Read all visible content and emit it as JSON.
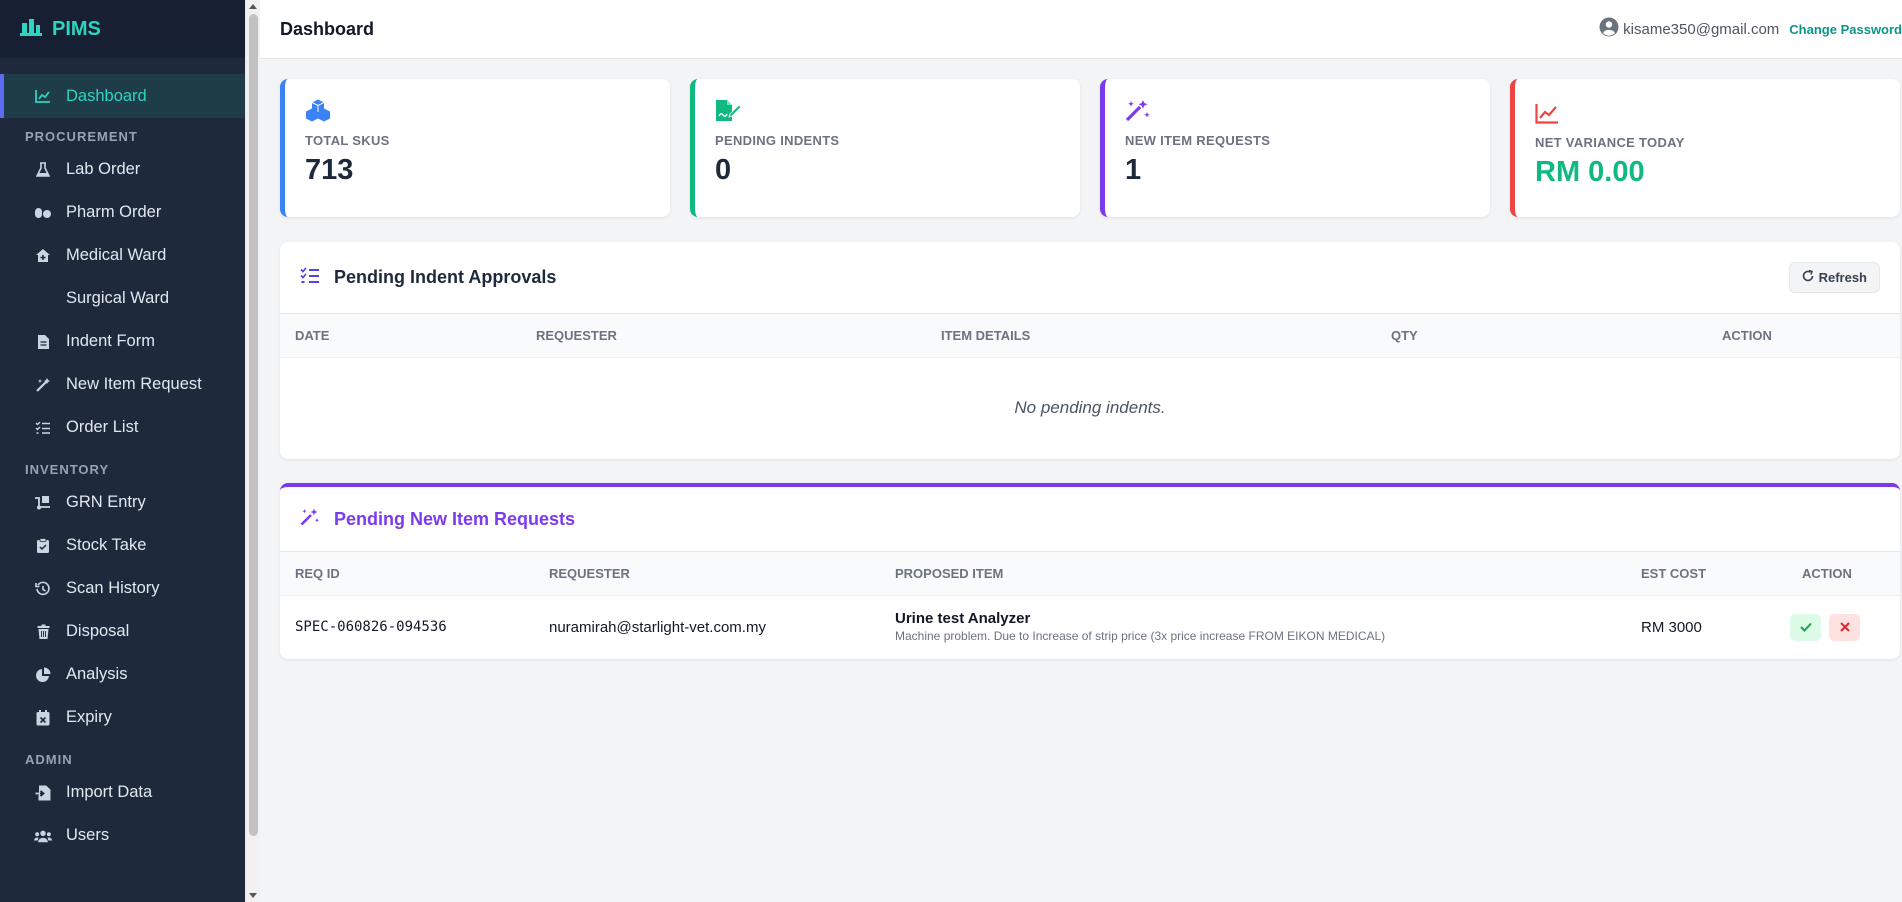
{
  "brand": {
    "name": "PIMS"
  },
  "sidebar": {
    "dashboard": "Dashboard",
    "sections": [
      {
        "label": "PROCUREMENT",
        "items": [
          {
            "label": "Lab Order",
            "icon": "flask-icon"
          },
          {
            "label": "Pharm Order",
            "icon": "pills-icon"
          },
          {
            "label": "Medical Ward",
            "icon": "house-medical-icon"
          },
          {
            "label": "Surgical Ward",
            "icon": ""
          },
          {
            "label": "Indent Form",
            "icon": "file-icon"
          },
          {
            "label": "New Item Request",
            "icon": "magic-wand-icon"
          },
          {
            "label": "Order List",
            "icon": "list-check-icon"
          }
        ]
      },
      {
        "label": "INVENTORY",
        "items": [
          {
            "label": "GRN Entry",
            "icon": "truck-ramp-icon"
          },
          {
            "label": "Stock Take",
            "icon": "clipboard-check-icon"
          },
          {
            "label": "Scan History",
            "icon": "history-icon"
          },
          {
            "label": "Disposal",
            "icon": "trash-icon"
          },
          {
            "label": "Analysis",
            "icon": "pie-chart-icon"
          },
          {
            "label": "Expiry",
            "icon": "calendar-x-icon"
          }
        ]
      },
      {
        "label": "ADMIN",
        "items": [
          {
            "label": "Import Data",
            "icon": "file-import-icon"
          },
          {
            "label": "Users",
            "icon": "users-icon"
          }
        ]
      }
    ]
  },
  "header": {
    "title": "Dashboard",
    "user_email": "kisame350@gmail.com",
    "change_password": "Change Password"
  },
  "stats": [
    {
      "label": "TOTAL SKUS",
      "value": "713",
      "color": "#3b82f6",
      "icon": "cubes-icon"
    },
    {
      "label": "PENDING INDENTS",
      "value": "0",
      "color": "#10b981",
      "icon": "file-signature-icon"
    },
    {
      "label": "NEW ITEM REQUESTS",
      "value": "1",
      "color": "#7c3aed",
      "icon": "magic-wand-icon"
    },
    {
      "label": "NET VARIANCE TODAY",
      "value": "RM 0.00",
      "color": "#ef4444",
      "icon": "line-chart-icon",
      "value_color": "#10b981"
    }
  ],
  "indent_panel": {
    "title": "Pending Indent Approvals",
    "refresh": "Refresh",
    "columns": [
      "DATE",
      "REQUESTER",
      "ITEM DETAILS",
      "QTY",
      "ACTION"
    ],
    "empty_text": "No pending indents."
  },
  "request_panel": {
    "title": "Pending New Item Requests",
    "columns": [
      "REQ ID",
      "REQUESTER",
      "PROPOSED ITEM",
      "EST COST",
      "ACTION"
    ],
    "rows": [
      {
        "req_id": "SPEC-060826-094536",
        "requester": "nuramirah@starlight-vet.com.my",
        "item_name": "Urine test Analyzer",
        "item_desc": "Machine problem. Due to Increase of strip price (3x price increase FROM EIKON MEDICAL)",
        "cost": "RM 3000"
      }
    ]
  },
  "colors": {
    "accent": "#2dd4bf",
    "purple": "#7c3aed",
    "approve": "#16a34a",
    "reject": "#dc2626"
  }
}
